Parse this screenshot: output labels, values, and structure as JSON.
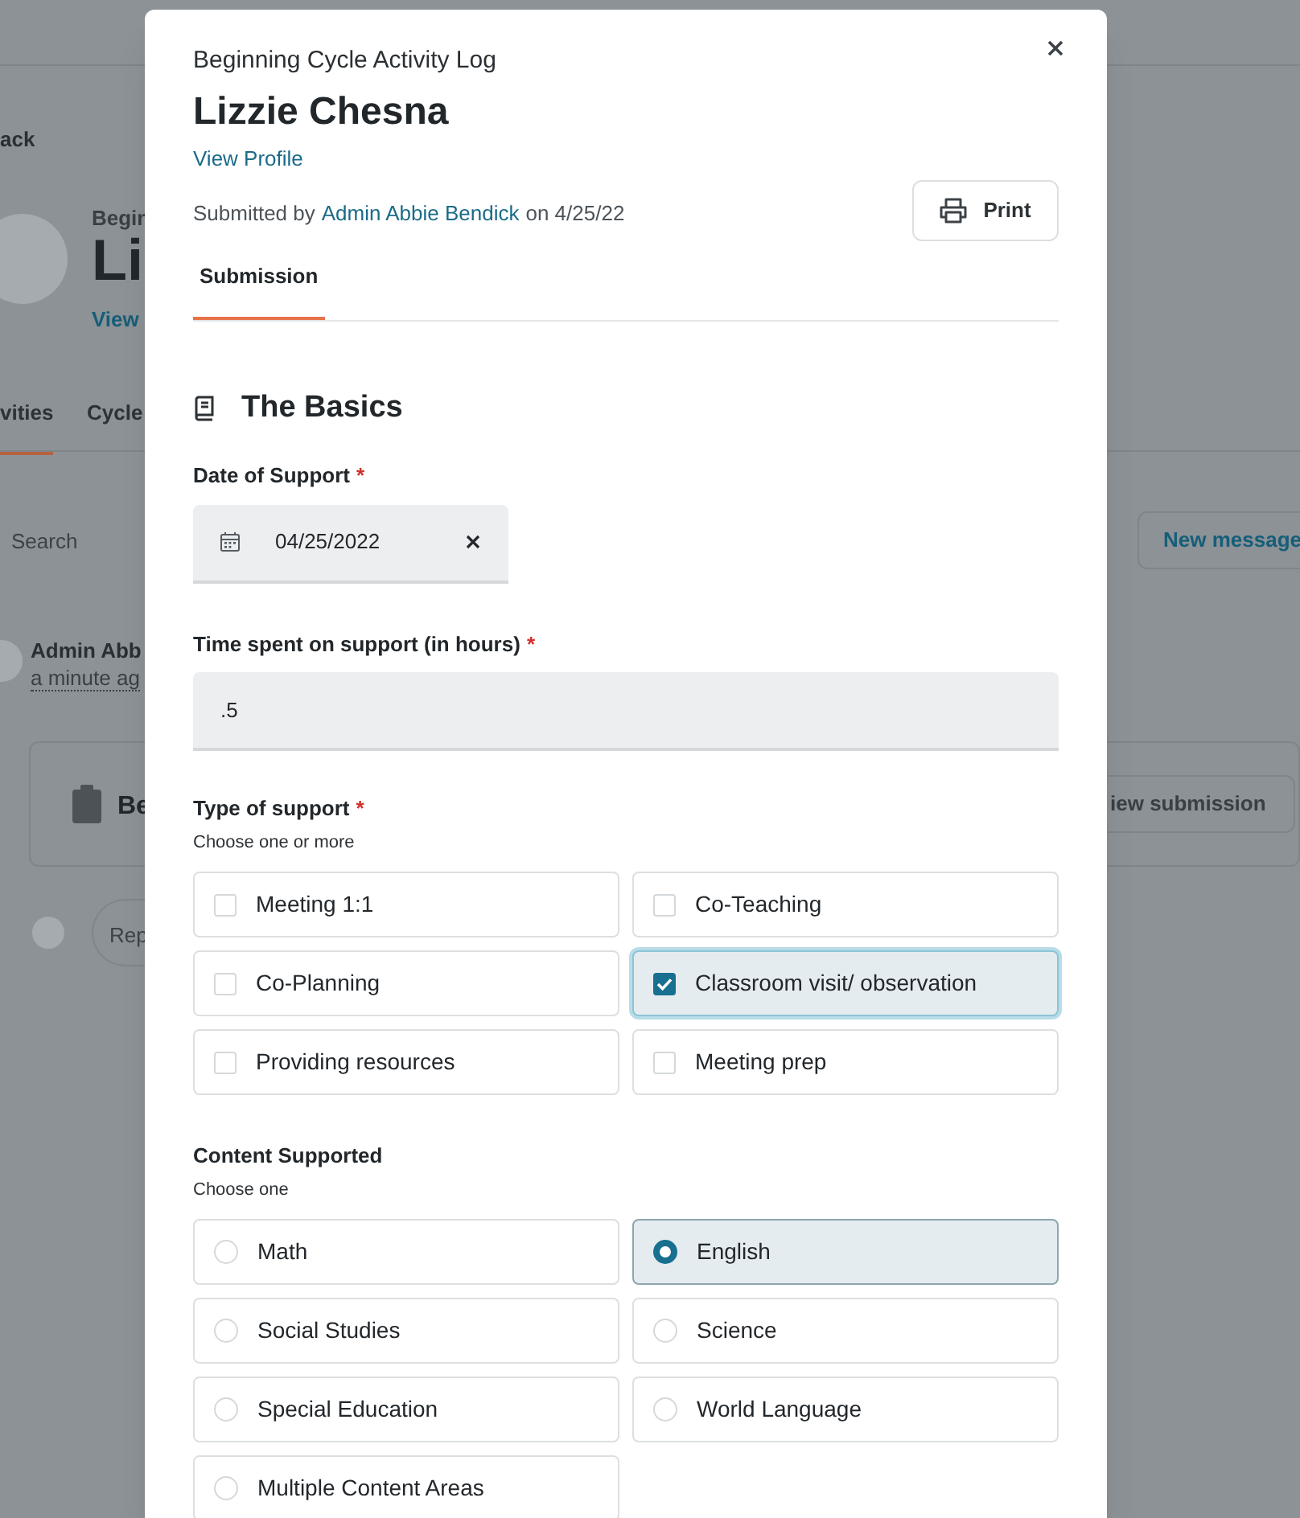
{
  "background": {
    "back_link": "ack",
    "profile": {
      "subtitle": "Begin",
      "name": "Li",
      "link": "View"
    },
    "tabs": [
      {
        "label": "vities",
        "selected": true
      },
      {
        "label": "Cycle",
        "selected": false
      }
    ],
    "search": {
      "placeholder": "Search"
    },
    "new_message_button": "New message",
    "activity": {
      "author": "Admin Abb",
      "time": "a minute ag",
      "card_title": "Be",
      "view_button": "iew submission"
    },
    "reply": {
      "placeholder": "Rep"
    }
  },
  "modal": {
    "subtitle": "Beginning Cycle Activity Log",
    "name": "Lizzie Chesna",
    "view_profile": "View Profile",
    "submitted": {
      "prefix": "Submitted by",
      "author": "Admin Abbie Bendick",
      "suffix": "on 4/25/22"
    },
    "print_button": "Print",
    "tabs": [
      {
        "label": "Submission",
        "selected": true
      }
    ],
    "section_title": "The Basics",
    "fields": [
      {
        "kind": "date",
        "label": "Date of Support",
        "required_mark": "*",
        "value": "04/25/2022"
      },
      {
        "kind": "text",
        "label": "Time spent on support (in hours)",
        "required_mark": "*",
        "value": ".5"
      },
      {
        "kind": "checkboxes",
        "label": "Type of support",
        "required_mark": "*",
        "hint": "Choose one or more",
        "options": [
          {
            "label": "Meeting 1:1",
            "checked": false
          },
          {
            "label": "Co-Teaching",
            "checked": false
          },
          {
            "label": "Co-Planning",
            "checked": false
          },
          {
            "label": "Classroom visit/ observation",
            "checked": true
          },
          {
            "label": "Providing resources",
            "checked": false
          },
          {
            "label": "Meeting prep",
            "checked": false
          }
        ]
      },
      {
        "kind": "radios",
        "label": "Content Supported",
        "hint": "Choose one",
        "options": [
          {
            "label": "Math",
            "selected": false
          },
          {
            "label": "English",
            "selected": true
          },
          {
            "label": "Social Studies",
            "selected": false
          },
          {
            "label": "Science",
            "selected": false
          },
          {
            "label": "Special Education",
            "selected": false
          },
          {
            "label": "World Language",
            "selected": false
          },
          {
            "label": "Multiple Content Areas",
            "selected": false
          }
        ]
      }
    ]
  }
}
